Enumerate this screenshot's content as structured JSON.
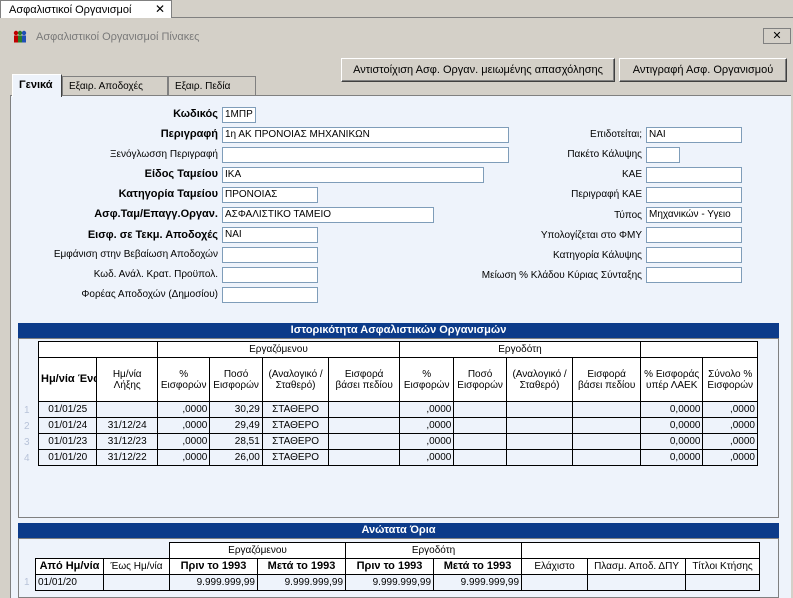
{
  "doc_tab": {
    "label": "Ασφαλιστικοί Οργανισμοί",
    "close": "✕"
  },
  "window": {
    "title": "Ασφαλιστικοί Οργανισμοί Πίνακες",
    "close": "✕"
  },
  "toolbar": {
    "mapping_button": "Αντιστοίχιση Ασφ. Οργαν. μειωμένης απασχόλησης",
    "copy_button": "Αντιγραφή Ασφ. Οργανισμού"
  },
  "tabs": [
    {
      "label": "Γενικά"
    },
    {
      "label": "Εξαιρ. Αποδοχές"
    },
    {
      "label": "Εξαιρ. Πεδία"
    }
  ],
  "left_fields": [
    {
      "label": "Κωδικός",
      "value": "1ΜΠΡ"
    },
    {
      "label": "Περιγραφή",
      "value": "1η ΑΚ ΠΡΟΝΟΙΑΣ ΜΗΧΑΝΙΚΩΝ"
    },
    {
      "label": "Ξενόγλωσση Περιγραφή",
      "value": ""
    },
    {
      "label": "Είδος Ταμείου",
      "value": "ΙΚΑ"
    },
    {
      "label": "Κατηγορία Ταμείου",
      "value": "ΠΡΟΝΟΙΑΣ"
    },
    {
      "label": "Ασφ.Ταμ/Επαγγ.Οργαν.",
      "value": "ΑΣΦΑΛΙΣΤΙΚΟ ΤΑΜΕΙΟ"
    },
    {
      "label": "Εισφ. σε Τεκμ. Αποδοχές",
      "value": "ΝΑΙ"
    },
    {
      "label": "Εμφάνιση στην Βεβαίωση Αποδοχών",
      "value": ""
    },
    {
      "label": "Κωδ. Ανάλ. Κρατ. Προϋπολ.",
      "value": ""
    },
    {
      "label": "Φορέας Αποδοχών (Δημοσίου)",
      "value": ""
    }
  ],
  "right_fields": [
    {
      "label": "Επιδοτείται;",
      "value": "ΝΑΙ"
    },
    {
      "label": "Πακέτο Κάλυψης",
      "value": ""
    },
    {
      "label": "ΚΑΕ",
      "value": ""
    },
    {
      "label": "Περιγραφή ΚΑΕ",
      "value": ""
    },
    {
      "label": "Τύπος",
      "value": "Μηχανικών - Υγειο"
    },
    {
      "label": "Υπολογίζεται στο ΦΜΥ",
      "value": ""
    },
    {
      "label": "Κατηγορία Κάλυψης",
      "value": ""
    },
    {
      "label": "Μείωση % Κλάδου Κύριας Σύνταξης",
      "value": ""
    }
  ],
  "history": {
    "title": "Ιστορικότητα Ασφαλιστικών Οργανισμών",
    "group_employee": "Εργαζόμενου",
    "group_employer": "Εργοδότη",
    "columns": [
      "Ημ/νία Έναρξης",
      "Ημ/νία Λήξης",
      "% Εισφορών",
      "Ποσό Εισφορών",
      "(Αναλογικό / Σταθερό)",
      "Εισφορά βάσει πεδίου",
      "% Εισφορών",
      "Ποσό Εισφορών",
      "(Αναλογικό / Σταθερό)",
      "Εισφορά βάσει πεδίου",
      "% Εισφοράς υπέρ ΛΑΕΚ",
      "Σύνολο % Εισφορών"
    ],
    "rows": [
      {
        "num": "1",
        "cells": [
          "01/01/25",
          "",
          ",0000",
          "30,29",
          "ΣΤΑΘΕΡΟ",
          "",
          ",0000",
          "",
          "",
          "",
          "0,0000",
          ",0000"
        ]
      },
      {
        "num": "2",
        "cells": [
          "01/01/24",
          "31/12/24",
          ",0000",
          "29,49",
          "ΣΤΑΘΕΡΟ",
          "",
          ",0000",
          "",
          "",
          "",
          "0,0000",
          ",0000"
        ]
      },
      {
        "num": "3",
        "cells": [
          "01/01/23",
          "31/12/23",
          ",0000",
          "28,51",
          "ΣΤΑΘΕΡΟ",
          "",
          ",0000",
          "",
          "",
          "",
          "0,0000",
          ",0000"
        ]
      },
      {
        "num": "4",
        "cells": [
          "01/01/20",
          "31/12/22",
          ",0000",
          "26,00",
          "ΣΤΑΘΕΡΟ",
          "",
          ",0000",
          "",
          "",
          "",
          "0,0000",
          ",0000"
        ]
      }
    ]
  },
  "limits": {
    "title": "Ανώτατα Όρια",
    "group_employee": "Εργαζόμενου",
    "group_employer": "Εργοδότη",
    "columns": [
      "Από Ημ/νία",
      "Έως Ημ/νία",
      "Πριν το 1993",
      "Μετά το 1993",
      "Πριν το 1993",
      "Μετά το 1993",
      "Ελάχιστο",
      "Πλασμ. Αποδ. ΔΠΥ",
      "Τίτλοι Κτήσης"
    ],
    "rows": [
      {
        "num": "1",
        "cells": [
          "01/01/20",
          "",
          "9.999.999,99",
          "9.999.999,99",
          "9.999.999,99",
          "9.999.999,99",
          "",
          "",
          ""
        ]
      }
    ]
  }
}
